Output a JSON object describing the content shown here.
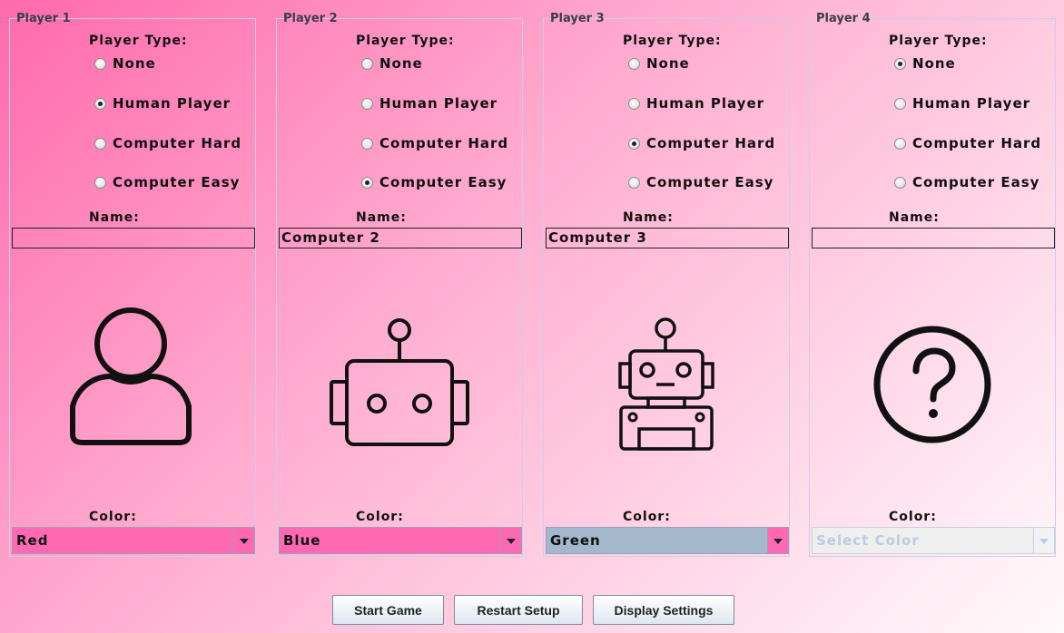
{
  "common": {
    "player_type_label": "Player Type:",
    "name_label": "Name:",
    "color_label": "Color:"
  },
  "players": [
    {
      "title": "Player 1",
      "options": [
        "None",
        "Human Player",
        "Computer Hard",
        "Computer Easy"
      ],
      "selected": "Human Player",
      "name": "",
      "color": "Red",
      "color_hex": "#ff69b4",
      "avatar": "person-icon",
      "color_enabled": true
    },
    {
      "title": "Player 2",
      "options": [
        "None",
        "Human Player",
        "Computer Hard",
        "Computer Easy"
      ],
      "selected": "Computer Easy",
      "name": "Computer 2",
      "color": "Blue",
      "color_hex": "#ff69b4",
      "avatar": "robot-easy-icon",
      "color_enabled": true
    },
    {
      "title": "Player 3",
      "options": [
        "None",
        "Human Player",
        "Computer Hard",
        "Computer Easy"
      ],
      "selected": "Computer Hard",
      "name": "Computer 3",
      "color": "Green",
      "color_hex": "#a3b8cc",
      "avatar": "robot-hard-icon",
      "color_enabled": true
    },
    {
      "title": "Player 4",
      "options": [
        "None",
        "Human Player",
        "Computer Hard",
        "Computer Easy"
      ],
      "selected": "None",
      "name": "",
      "color": "Select Color",
      "color_hex": "#efeff0",
      "avatar": "question-mark-icon",
      "color_enabled": false
    }
  ],
  "buttons": {
    "start": "Start Game",
    "restart": "Restart Setup",
    "display": "Display Settings"
  }
}
